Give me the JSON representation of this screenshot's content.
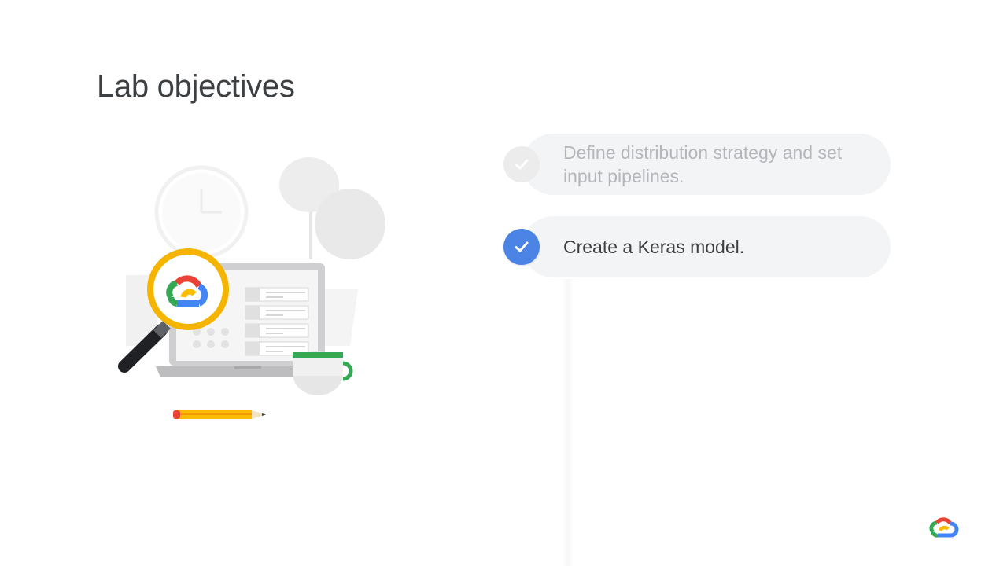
{
  "slide": {
    "title": "Lab objectives"
  },
  "objectives": [
    {
      "label": "Define distribution strategy and set input pipelines.",
      "state": "completed-faded"
    },
    {
      "label": "Create a Keras model.",
      "state": "current"
    }
  ],
  "icons": {
    "illustration": "magnifier-laptop-illustration-icon",
    "check": "checkmark-icon",
    "logo": "google-cloud-logo-icon"
  },
  "colors": {
    "check_active": "#4c84e6",
    "check_faded": "#ececec",
    "pill_background": "#f3f4f5",
    "title_text": "#3c4043",
    "faded_text": "#b3b6ba",
    "google_blue": "#4285f4",
    "google_red": "#ea4335",
    "google_yellow": "#fbbc04",
    "google_green": "#34a853"
  }
}
